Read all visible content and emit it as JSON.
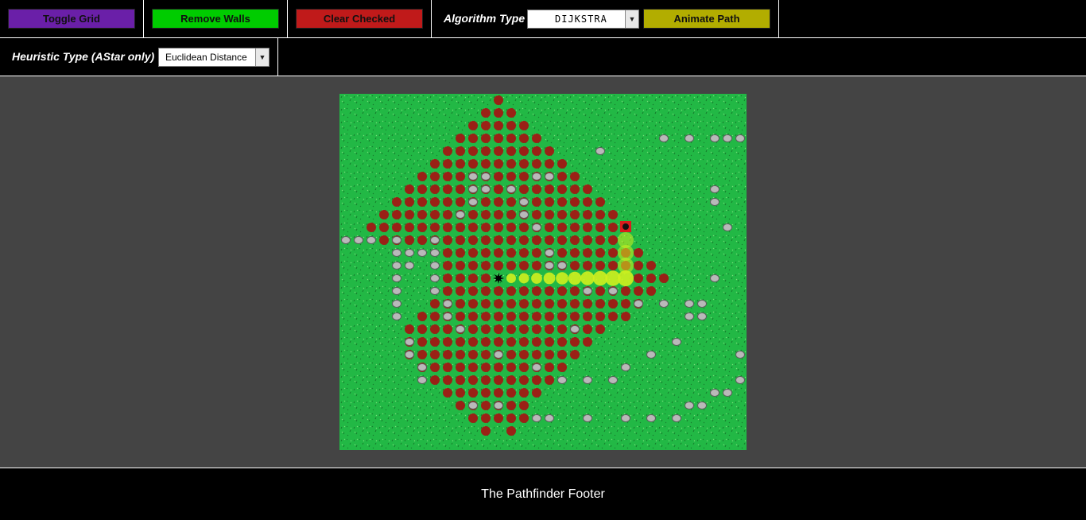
{
  "toolbar": {
    "toggle_grid": "Toggle Grid",
    "remove_walls": "Remove Walls",
    "clear_checked": "Clear Checked",
    "algorithm_label": "Algorithm Type",
    "algorithm_value": "DIJKSTRA",
    "animate_path": "Animate Path",
    "heuristic_label": "Heuristic Type (AStar only)",
    "heuristic_value": "Euclidean Distance"
  },
  "colors": {
    "toggle_grid": "#6a1fa8",
    "remove_walls": "#00cc00",
    "clear_checked": "#c01a1a",
    "animate_path": "#b2ad00",
    "grass": "#22b845",
    "checked_dot": "#9a2116",
    "path_dot": "#cff01e",
    "rock": "#b9b9b9"
  },
  "grid": {
    "cols": 32,
    "rows": 28,
    "start": [
      12,
      14
    ],
    "goal": [
      22,
      10
    ],
    "checked": [
      [
        12,
        0
      ],
      [
        11,
        1
      ],
      [
        12,
        1
      ],
      [
        13,
        1
      ],
      [
        10,
        2
      ],
      [
        11,
        2
      ],
      [
        12,
        2
      ],
      [
        13,
        2
      ],
      [
        14,
        2
      ],
      [
        9,
        3
      ],
      [
        10,
        3
      ],
      [
        11,
        3
      ],
      [
        12,
        3
      ],
      [
        13,
        3
      ],
      [
        14,
        3
      ],
      [
        15,
        3
      ],
      [
        8,
        4
      ],
      [
        9,
        4
      ],
      [
        10,
        4
      ],
      [
        11,
        4
      ],
      [
        12,
        4
      ],
      [
        13,
        4
      ],
      [
        14,
        4
      ],
      [
        15,
        4
      ],
      [
        16,
        4
      ],
      [
        7,
        5
      ],
      [
        8,
        5
      ],
      [
        9,
        5
      ],
      [
        10,
        5
      ],
      [
        11,
        5
      ],
      [
        12,
        5
      ],
      [
        13,
        5
      ],
      [
        14,
        5
      ],
      [
        15,
        5
      ],
      [
        16,
        5
      ],
      [
        17,
        5
      ],
      [
        6,
        6
      ],
      [
        7,
        6
      ],
      [
        8,
        6
      ],
      [
        9,
        6
      ],
      [
        10,
        6
      ],
      [
        11,
        6
      ],
      [
        12,
        6
      ],
      [
        13,
        6
      ],
      [
        14,
        6
      ],
      [
        15,
        6
      ],
      [
        16,
        6
      ],
      [
        17,
        6
      ],
      [
        18,
        6
      ],
      [
        5,
        7
      ],
      [
        6,
        7
      ],
      [
        7,
        7
      ],
      [
        8,
        7
      ],
      [
        9,
        7
      ],
      [
        10,
        7
      ],
      [
        11,
        7
      ],
      [
        12,
        7
      ],
      [
        13,
        7
      ],
      [
        14,
        7
      ],
      [
        15,
        7
      ],
      [
        16,
        7
      ],
      [
        17,
        7
      ],
      [
        18,
        7
      ],
      [
        19,
        7
      ],
      [
        4,
        8
      ],
      [
        5,
        8
      ],
      [
        6,
        8
      ],
      [
        7,
        8
      ],
      [
        8,
        8
      ],
      [
        9,
        8
      ],
      [
        10,
        8
      ],
      [
        11,
        8
      ],
      [
        12,
        8
      ],
      [
        13,
        8
      ],
      [
        14,
        8
      ],
      [
        15,
        8
      ],
      [
        16,
        8
      ],
      [
        17,
        8
      ],
      [
        18,
        8
      ],
      [
        19,
        8
      ],
      [
        20,
        8
      ],
      [
        3,
        9
      ],
      [
        4,
        9
      ],
      [
        5,
        9
      ],
      [
        6,
        9
      ],
      [
        7,
        9
      ],
      [
        8,
        9
      ],
      [
        9,
        9
      ],
      [
        10,
        9
      ],
      [
        11,
        9
      ],
      [
        12,
        9
      ],
      [
        13,
        9
      ],
      [
        14,
        9
      ],
      [
        15,
        9
      ],
      [
        16,
        9
      ],
      [
        17,
        9
      ],
      [
        18,
        9
      ],
      [
        19,
        9
      ],
      [
        20,
        9
      ],
      [
        21,
        9
      ],
      [
        2,
        10
      ],
      [
        3,
        10
      ],
      [
        4,
        10
      ],
      [
        5,
        10
      ],
      [
        6,
        10
      ],
      [
        7,
        10
      ],
      [
        8,
        10
      ],
      [
        9,
        10
      ],
      [
        10,
        10
      ],
      [
        11,
        10
      ],
      [
        12,
        10
      ],
      [
        13,
        10
      ],
      [
        14,
        10
      ],
      [
        15,
        10
      ],
      [
        16,
        10
      ],
      [
        17,
        10
      ],
      [
        18,
        10
      ],
      [
        19,
        10
      ],
      [
        20,
        10
      ],
      [
        21,
        10
      ],
      [
        3,
        11
      ],
      [
        4,
        11
      ],
      [
        5,
        11
      ],
      [
        6,
        11
      ],
      [
        7,
        11
      ],
      [
        8,
        11
      ],
      [
        9,
        11
      ],
      [
        10,
        11
      ],
      [
        11,
        11
      ],
      [
        12,
        11
      ],
      [
        13,
        11
      ],
      [
        14,
        11
      ],
      [
        15,
        11
      ],
      [
        16,
        11
      ],
      [
        17,
        11
      ],
      [
        18,
        11
      ],
      [
        19,
        11
      ],
      [
        20,
        11
      ],
      [
        21,
        11
      ],
      [
        8,
        12
      ],
      [
        9,
        12
      ],
      [
        10,
        12
      ],
      [
        11,
        12
      ],
      [
        12,
        12
      ],
      [
        13,
        12
      ],
      [
        14,
        12
      ],
      [
        15,
        12
      ],
      [
        16,
        12
      ],
      [
        17,
        12
      ],
      [
        18,
        12
      ],
      [
        19,
        12
      ],
      [
        20,
        12
      ],
      [
        21,
        12
      ],
      [
        22,
        12
      ],
      [
        23,
        12
      ],
      [
        8,
        13
      ],
      [
        9,
        13
      ],
      [
        10,
        13
      ],
      [
        11,
        13
      ],
      [
        12,
        13
      ],
      [
        13,
        13
      ],
      [
        14,
        13
      ],
      [
        15,
        13
      ],
      [
        16,
        13
      ],
      [
        17,
        13
      ],
      [
        18,
        13
      ],
      [
        19,
        13
      ],
      [
        20,
        13
      ],
      [
        21,
        13
      ],
      [
        22,
        13
      ],
      [
        23,
        13
      ],
      [
        24,
        13
      ],
      [
        8,
        14
      ],
      [
        9,
        14
      ],
      [
        10,
        14
      ],
      [
        11,
        14
      ],
      [
        23,
        14
      ],
      [
        24,
        14
      ],
      [
        25,
        14
      ],
      [
        8,
        15
      ],
      [
        9,
        15
      ],
      [
        10,
        15
      ],
      [
        11,
        15
      ],
      [
        12,
        15
      ],
      [
        13,
        15
      ],
      [
        14,
        15
      ],
      [
        15,
        15
      ],
      [
        16,
        15
      ],
      [
        17,
        15
      ],
      [
        18,
        15
      ],
      [
        19,
        15
      ],
      [
        20,
        15
      ],
      [
        21,
        15
      ],
      [
        22,
        15
      ],
      [
        23,
        15
      ],
      [
        24,
        15
      ],
      [
        7,
        16
      ],
      [
        8,
        16
      ],
      [
        9,
        16
      ],
      [
        10,
        16
      ],
      [
        11,
        16
      ],
      [
        12,
        16
      ],
      [
        13,
        16
      ],
      [
        14,
        16
      ],
      [
        15,
        16
      ],
      [
        16,
        16
      ],
      [
        17,
        16
      ],
      [
        18,
        16
      ],
      [
        19,
        16
      ],
      [
        20,
        16
      ],
      [
        21,
        16
      ],
      [
        22,
        16
      ],
      [
        23,
        16
      ],
      [
        6,
        17
      ],
      [
        7,
        17
      ],
      [
        8,
        17
      ],
      [
        9,
        17
      ],
      [
        10,
        17
      ],
      [
        11,
        17
      ],
      [
        12,
        17
      ],
      [
        13,
        17
      ],
      [
        14,
        17
      ],
      [
        15,
        17
      ],
      [
        16,
        17
      ],
      [
        17,
        17
      ],
      [
        18,
        17
      ],
      [
        19,
        17
      ],
      [
        20,
        17
      ],
      [
        21,
        17
      ],
      [
        22,
        17
      ],
      [
        5,
        18
      ],
      [
        6,
        18
      ],
      [
        7,
        18
      ],
      [
        8,
        18
      ],
      [
        9,
        18
      ],
      [
        10,
        18
      ],
      [
        11,
        18
      ],
      [
        12,
        18
      ],
      [
        13,
        18
      ],
      [
        14,
        18
      ],
      [
        15,
        18
      ],
      [
        16,
        18
      ],
      [
        17,
        18
      ],
      [
        18,
        18
      ],
      [
        19,
        18
      ],
      [
        20,
        18
      ],
      [
        5,
        19
      ],
      [
        6,
        19
      ],
      [
        7,
        19
      ],
      [
        8,
        19
      ],
      [
        9,
        19
      ],
      [
        10,
        19
      ],
      [
        11,
        19
      ],
      [
        12,
        19
      ],
      [
        13,
        19
      ],
      [
        14,
        19
      ],
      [
        15,
        19
      ],
      [
        16,
        19
      ],
      [
        17,
        19
      ],
      [
        18,
        19
      ],
      [
        19,
        19
      ],
      [
        5,
        20
      ],
      [
        6,
        20
      ],
      [
        7,
        20
      ],
      [
        8,
        20
      ],
      [
        9,
        20
      ],
      [
        10,
        20
      ],
      [
        11,
        20
      ],
      [
        12,
        20
      ],
      [
        13,
        20
      ],
      [
        14,
        20
      ],
      [
        15,
        20
      ],
      [
        16,
        20
      ],
      [
        17,
        20
      ],
      [
        18,
        20
      ],
      [
        6,
        21
      ],
      [
        7,
        21
      ],
      [
        8,
        21
      ],
      [
        9,
        21
      ],
      [
        10,
        21
      ],
      [
        11,
        21
      ],
      [
        12,
        21
      ],
      [
        13,
        21
      ],
      [
        14,
        21
      ],
      [
        15,
        21
      ],
      [
        16,
        21
      ],
      [
        17,
        21
      ],
      [
        7,
        22
      ],
      [
        8,
        22
      ],
      [
        9,
        22
      ],
      [
        10,
        22
      ],
      [
        11,
        22
      ],
      [
        12,
        22
      ],
      [
        13,
        22
      ],
      [
        14,
        22
      ],
      [
        15,
        22
      ],
      [
        16,
        22
      ],
      [
        8,
        23
      ],
      [
        9,
        23
      ],
      [
        10,
        23
      ],
      [
        11,
        23
      ],
      [
        12,
        23
      ],
      [
        13,
        23
      ],
      [
        14,
        23
      ],
      [
        15,
        23
      ],
      [
        9,
        24
      ],
      [
        10,
        24
      ],
      [
        11,
        24
      ],
      [
        12,
        24
      ],
      [
        13,
        24
      ],
      [
        14,
        24
      ],
      [
        10,
        25
      ],
      [
        11,
        25
      ],
      [
        12,
        25
      ],
      [
        13,
        25
      ],
      [
        14,
        25
      ],
      [
        11,
        26
      ],
      [
        13,
        26
      ]
    ],
    "path": [
      [
        13,
        14
      ],
      [
        14,
        14
      ],
      [
        15,
        14
      ],
      [
        16,
        14
      ],
      [
        17,
        14
      ],
      [
        18,
        14
      ],
      [
        19,
        14
      ],
      [
        20,
        14
      ],
      [
        21,
        14
      ],
      [
        22,
        14
      ],
      [
        22,
        13
      ],
      [
        22,
        12
      ],
      [
        22,
        11
      ]
    ],
    "rocks": [
      [
        25,
        3
      ],
      [
        27,
        3
      ],
      [
        29,
        3
      ],
      [
        30,
        3
      ],
      [
        31,
        3
      ],
      [
        20,
        4
      ],
      [
        10,
        6
      ],
      [
        11,
        6
      ],
      [
        15,
        6
      ],
      [
        16,
        6
      ],
      [
        10,
        7
      ],
      [
        11,
        7
      ],
      [
        13,
        7
      ],
      [
        29,
        7
      ],
      [
        10,
        8
      ],
      [
        14,
        8
      ],
      [
        29,
        8
      ],
      [
        9,
        9
      ],
      [
        14,
        9
      ],
      [
        15,
        10
      ],
      [
        30,
        10
      ],
      [
        0,
        11
      ],
      [
        1,
        11
      ],
      [
        2,
        11
      ],
      [
        4,
        11
      ],
      [
        7,
        11
      ],
      [
        4,
        12
      ],
      [
        5,
        12
      ],
      [
        6,
        12
      ],
      [
        7,
        12
      ],
      [
        16,
        12
      ],
      [
        4,
        13
      ],
      [
        5,
        13
      ],
      [
        7,
        13
      ],
      [
        16,
        13
      ],
      [
        17,
        13
      ],
      [
        4,
        14
      ],
      [
        7,
        14
      ],
      [
        29,
        14
      ],
      [
        4,
        15
      ],
      [
        7,
        15
      ],
      [
        19,
        15
      ],
      [
        21,
        15
      ],
      [
        4,
        16
      ],
      [
        8,
        16
      ],
      [
        23,
        16
      ],
      [
        25,
        16
      ],
      [
        27,
        16
      ],
      [
        28,
        16
      ],
      [
        4,
        17
      ],
      [
        8,
        17
      ],
      [
        27,
        17
      ],
      [
        28,
        17
      ],
      [
        9,
        18
      ],
      [
        18,
        18
      ],
      [
        5,
        19
      ],
      [
        26,
        19
      ],
      [
        5,
        20
      ],
      [
        12,
        20
      ],
      [
        24,
        20
      ],
      [
        31,
        20
      ],
      [
        6,
        21
      ],
      [
        15,
        21
      ],
      [
        22,
        21
      ],
      [
        6,
        22
      ],
      [
        17,
        22
      ],
      [
        19,
        22
      ],
      [
        21,
        22
      ],
      [
        31,
        22
      ],
      [
        29,
        23
      ],
      [
        30,
        23
      ],
      [
        10,
        24
      ],
      [
        12,
        24
      ],
      [
        27,
        24
      ],
      [
        28,
        24
      ],
      [
        15,
        25
      ],
      [
        16,
        25
      ],
      [
        19,
        25
      ],
      [
        22,
        25
      ],
      [
        24,
        25
      ],
      [
        26,
        25
      ]
    ]
  },
  "footer": {
    "text": "The Pathfinder Footer"
  }
}
